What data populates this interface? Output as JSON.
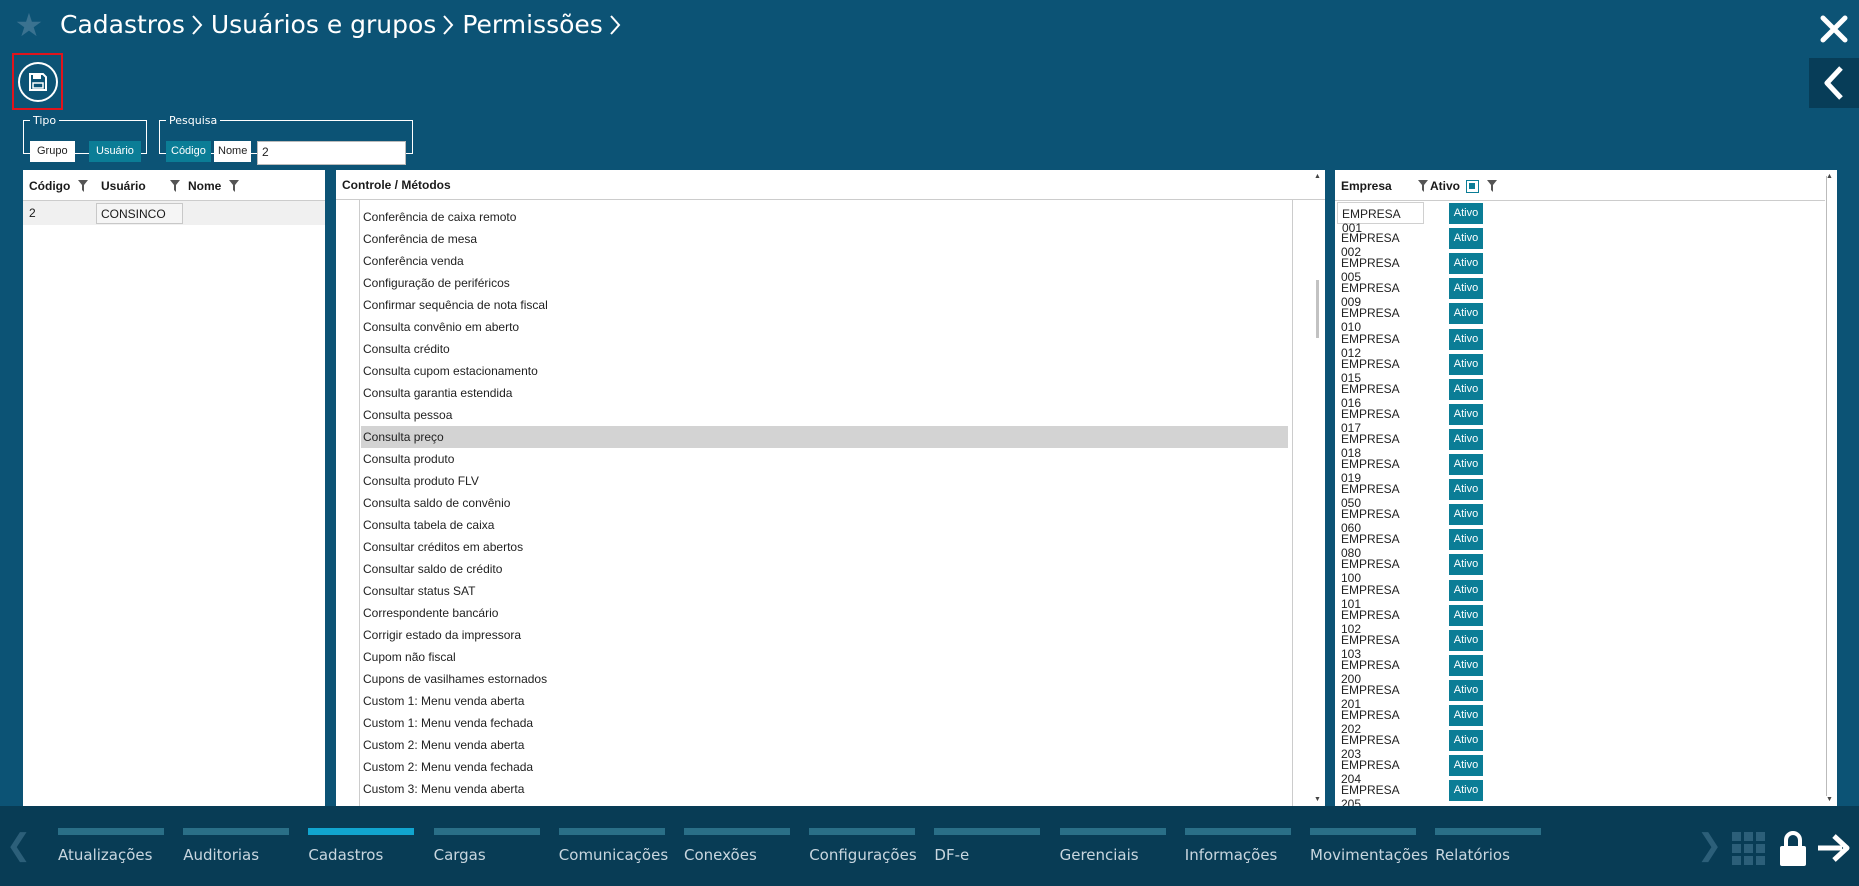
{
  "breadcrumb": [
    "Cadastros",
    "Usuários e grupos",
    "Permissões"
  ],
  "filters": {
    "tipo": {
      "legend": "Tipo",
      "options": [
        "Grupo",
        "Usuário"
      ],
      "selected": "Usuário"
    },
    "pesquisa": {
      "legend": "Pesquisa",
      "options": [
        "Código",
        "Nome"
      ],
      "selected": "Código",
      "value": "2"
    }
  },
  "users": {
    "columns": [
      "Código",
      "Usuário",
      "Nome"
    ],
    "rows": [
      {
        "codigo": "2",
        "usuario": "CONSINCO",
        "nome": ""
      }
    ]
  },
  "methods": {
    "header": "Controle / Métodos",
    "items": [
      "Conferência de caixa remoto",
      "Conferência de mesa",
      "Conferência venda",
      "Configuração de periféricos",
      "Confirmar sequência de nota fiscal",
      "Consulta convênio em aberto",
      "Consulta crédito",
      "Consulta cupom estacionamento",
      "Consulta garantia estendida",
      "Consulta pessoa",
      "Consulta preço",
      "Consulta produto",
      "Consulta produto FLV",
      "Consulta saldo de convênio",
      "Consulta tabela de caixa",
      "Consultar créditos em abertos",
      "Consultar saldo de crédito",
      "Consultar status SAT",
      "Correspondente bancário",
      "Corrigir estado da impressora",
      "Cupom não fiscal",
      "Cupons de vasilhames estornados",
      "Custom 1: Menu venda aberta",
      "Custom 1: Menu venda fechada",
      "Custom 2: Menu venda aberta",
      "Custom 2: Menu venda fechada",
      "Custom 3: Menu venda aberta"
    ],
    "selected": "Consulta preço"
  },
  "empresas": {
    "columns": [
      "Empresa",
      "Ativo"
    ],
    "status_label": "Ativo",
    "rows": [
      "EMPRESA 001",
      "EMPRESA 002",
      "EMPRESA 005",
      "EMPRESA 009",
      "EMPRESA 010",
      "EMPRESA 012",
      "EMPRESA 015",
      "EMPRESA 016",
      "EMPRESA 017",
      "EMPRESA 018",
      "EMPRESA 019",
      "EMPRESA 050",
      "EMPRESA 060",
      "EMPRESA 080",
      "EMPRESA 100",
      "EMPRESA 101",
      "EMPRESA 102",
      "EMPRESA 103",
      "EMPRESA 200",
      "EMPRESA 201",
      "EMPRESA 202",
      "EMPRESA 203",
      "EMPRESA 204",
      "EMPRESA 205"
    ]
  },
  "modules": [
    "Atualizações",
    "Auditorias",
    "Cadastros",
    "Cargas",
    "Comunicações",
    "Conexões",
    "Configurações",
    "DF-e",
    "Gerenciais",
    "Informações",
    "Movimentações",
    "Relatórios"
  ],
  "active_module": "Cadastros",
  "colors": {
    "background": "#0c5375",
    "accent": "#0b7d96",
    "bottom_bar": "#083c55",
    "active_module_bar": "#11a5cf",
    "save_highlight": "#e0141c"
  },
  "icons": [
    "star-icon",
    "chevron-right-icon",
    "close-icon",
    "back-arrow-icon",
    "save-icon",
    "filter-icon",
    "grid-icon",
    "lock-icon",
    "logout-icon"
  ]
}
